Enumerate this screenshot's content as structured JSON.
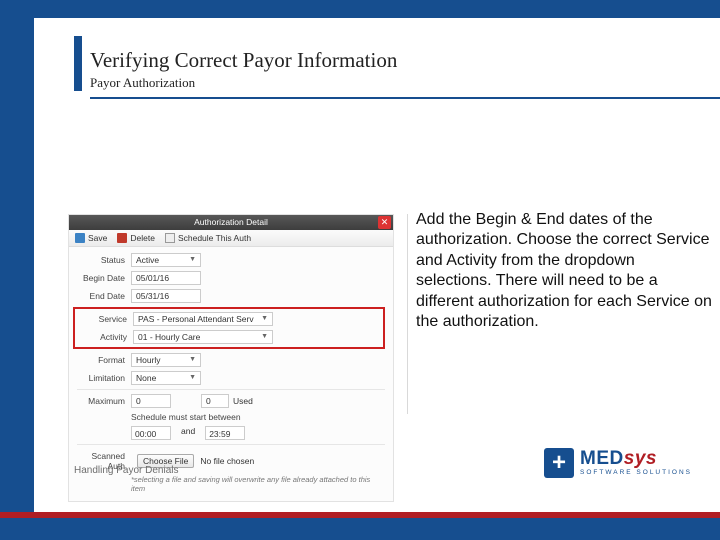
{
  "header": {
    "title": "Verifying Correct Payor Information",
    "subtitle": "Payor Authorization"
  },
  "panel": {
    "window_title": "Authorization Detail",
    "toolbar": {
      "save": "Save",
      "delete": "Delete",
      "schedule": "Schedule This Auth"
    },
    "fields": {
      "status_label": "Status",
      "status_value": "Active",
      "begin_label": "Begin Date",
      "begin_value": "05/01/16",
      "end_label": "End Date",
      "end_value": "05/31/16",
      "service_label": "Service",
      "service_value": "PAS - Personal Attendant Serv",
      "activity_label": "Activity",
      "activity_value": "01 - Hourly Care",
      "format_label": "Format",
      "format_value": "Hourly",
      "limitation_label": "Limitation",
      "limitation_value": "None",
      "maximum_label": "Maximum",
      "maximum_value": "0",
      "used_label": "Used",
      "used_value": "0",
      "sched_line": "Schedule must start between",
      "time_from": "00:00",
      "time_and": "and",
      "time_to": "23:59",
      "scanned_label": "Scanned Auth",
      "choose_file": "Choose File",
      "no_file": "No file chosen",
      "hint": "*selecting a file and saving will overwrite any file already attached to this item"
    }
  },
  "instruction": "Add the Begin & End dates of the authorization. Choose the correct Service and Activity from the dropdown selections. There will need to be a different authorization for each Service on the authorization.",
  "footer": {
    "left": "Handling Payor Denials",
    "brand_a": "MED",
    "brand_b": "sys",
    "tagline": "SOFTWARE SOLUTIONS"
  }
}
